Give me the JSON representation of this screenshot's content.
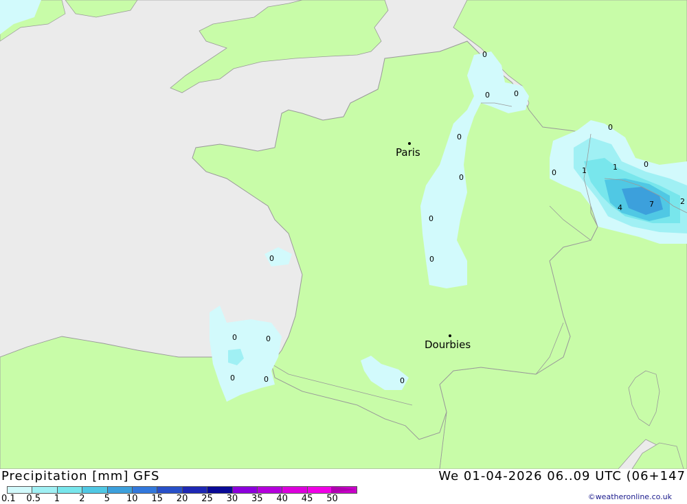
{
  "header": {
    "title_left": "Precipitation [mm] GFS",
    "title_right": "We 01-04-2026 06..09 UTC (06+147",
    "credit": "©weatheronline.co.uk"
  },
  "map": {
    "sea_color": "#ebebeb",
    "land_color": "#c8fca8",
    "border_color": "#999999",
    "cities": [
      {
        "name": "Paris"
      },
      {
        "name": "Dourbies"
      }
    ],
    "value_labels": [
      "0",
      "0",
      "0",
      "0",
      "0",
      "0",
      "0",
      "0",
      "0",
      "0",
      "0",
      "0",
      "0",
      "0",
      "0",
      "0",
      "1",
      "1",
      "4",
      "7",
      "2"
    ]
  },
  "legend": {
    "colors": [
      "#d2fafc",
      "#a0f0f4",
      "#78e6ec",
      "#50c8e4",
      "#3ca0dc",
      "#3278dc",
      "#2850c8",
      "#1e28b4",
      "#0a0a96",
      "#8c00dc",
      "#b400dc",
      "#dc00dc",
      "#f000e6",
      "#c800c8"
    ],
    "tick_labels": [
      "0.1",
      "0.5",
      "1",
      "2",
      "5",
      "10",
      "15",
      "20",
      "25",
      "30",
      "35",
      "40",
      "45",
      "50"
    ],
    "arrow_color": "#b000b0"
  }
}
